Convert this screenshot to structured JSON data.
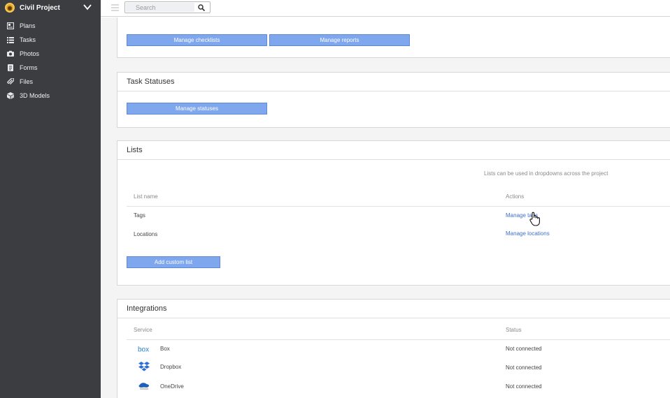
{
  "sidebar": {
    "project_name": "Civil Project",
    "items": [
      {
        "label": "Plans",
        "icon": "plans-icon"
      },
      {
        "label": "Tasks",
        "icon": "tasks-icon"
      },
      {
        "label": "Photos",
        "icon": "camera-icon"
      },
      {
        "label": "Forms",
        "icon": "forms-icon"
      },
      {
        "label": "Files",
        "icon": "paperclip-icon"
      },
      {
        "label": "3D Models",
        "icon": "cube-icon"
      }
    ]
  },
  "topbar": {
    "search_placeholder": "Search"
  },
  "sections": {
    "checklists": {
      "manage_checklists_label": "Manage checklists",
      "manage_reports_label": "Manage reports"
    },
    "task_statuses": {
      "title": "Task Statuses",
      "manage_statuses_label": "Manage statuses"
    },
    "lists": {
      "title": "Lists",
      "hint": "Lists can be used in dropdowns across the project",
      "col_name": "List name",
      "col_actions": "Actions",
      "rows": [
        {
          "name": "Tags",
          "action": "Manage tags"
        },
        {
          "name": "Locations",
          "action": "Manage locations"
        }
      ],
      "add_label": "Add custom list"
    },
    "integrations": {
      "title": "Integrations",
      "col_service": "Service",
      "col_status": "Status",
      "rows": [
        {
          "name": "Box",
          "status": "Not connected",
          "icon": "box-logo-icon"
        },
        {
          "name": "Dropbox",
          "status": "Not connected",
          "icon": "dropbox-logo-icon"
        },
        {
          "name": "OneDrive",
          "status": "Not connected",
          "icon": "onedrive-logo-icon"
        }
      ]
    }
  },
  "colors": {
    "sidebar_bg": "#3b3d40",
    "button_bg": "#7fa7ee",
    "link": "#3d6fd1",
    "main_bg": "#f4f4f4"
  }
}
